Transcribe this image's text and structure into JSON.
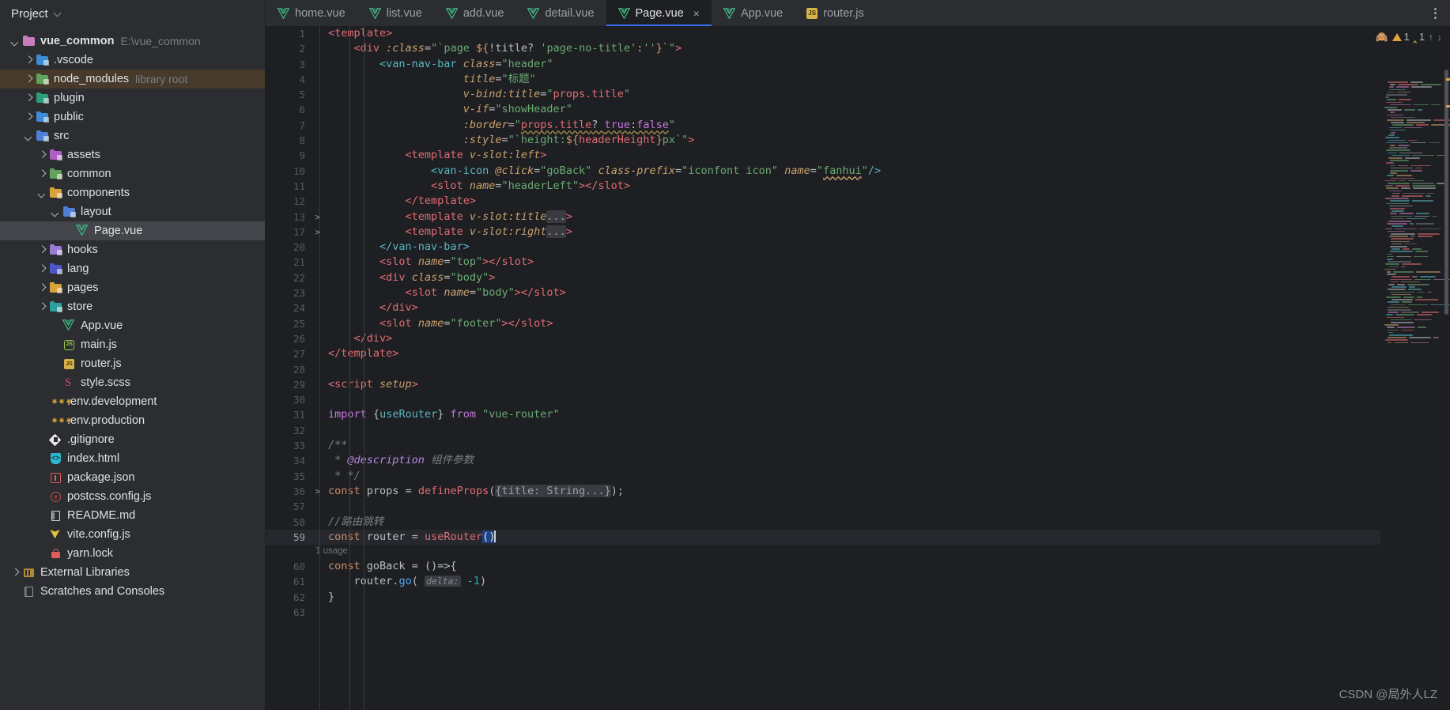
{
  "sidebar": {
    "title": "Project",
    "items": [
      {
        "label": "vue_common",
        "sub": "E:\\vue_common",
        "depth": 0,
        "twisty": "open",
        "icon": "folder-module",
        "color": "#c77dbb",
        "bold": true,
        "state": "normal"
      },
      {
        "label": ".vscode",
        "sub": "",
        "depth": 1,
        "twisty": "closed",
        "icon": "folder",
        "color": "#3c8cd6",
        "bold": false,
        "state": "normal"
      },
      {
        "label": "node_modules",
        "sub": "library root",
        "depth": 1,
        "twisty": "closed",
        "icon": "folder",
        "color": "#62a35c",
        "bold": false,
        "state": "brown"
      },
      {
        "label": "plugin",
        "sub": "",
        "depth": 1,
        "twisty": "closed",
        "icon": "folder",
        "color": "#2e9e7a",
        "bold": false,
        "state": "normal"
      },
      {
        "label": "public",
        "sub": "",
        "depth": 1,
        "twisty": "closed",
        "icon": "folder",
        "color": "#3c8cd6",
        "bold": false,
        "state": "normal"
      },
      {
        "label": "src",
        "sub": "",
        "depth": 1,
        "twisty": "open",
        "icon": "folder-source",
        "color": "#4f7fd6",
        "bold": false,
        "state": "normal"
      },
      {
        "label": "assets",
        "sub": "",
        "depth": 2,
        "twisty": "closed",
        "icon": "folder",
        "color": "#b05fc2",
        "bold": false,
        "state": "normal"
      },
      {
        "label": "common",
        "sub": "",
        "depth": 2,
        "twisty": "closed",
        "icon": "folder",
        "color": "#62a35c",
        "bold": false,
        "state": "normal"
      },
      {
        "label": "components",
        "sub": "",
        "depth": 2,
        "twisty": "open",
        "icon": "folder",
        "color": "#d8a33c",
        "bold": false,
        "state": "normal"
      },
      {
        "label": "layout",
        "sub": "",
        "depth": 3,
        "twisty": "open",
        "icon": "folder",
        "color": "#4f7fd6",
        "bold": false,
        "state": "normal"
      },
      {
        "label": "Page.vue",
        "sub": "",
        "depth": 4,
        "twisty": "none",
        "icon": "vue",
        "color": "#41b883",
        "bold": false,
        "state": "selected"
      },
      {
        "label": "hooks",
        "sub": "",
        "depth": 2,
        "twisty": "closed",
        "icon": "folder",
        "color": "#9b7ad6",
        "bold": false,
        "state": "normal"
      },
      {
        "label": "lang",
        "sub": "",
        "depth": 2,
        "twisty": "closed",
        "icon": "folder",
        "color": "#4a57c4",
        "bold": false,
        "state": "normal"
      },
      {
        "label": "pages",
        "sub": "",
        "depth": 2,
        "twisty": "closed",
        "icon": "folder",
        "color": "#d8a33c",
        "bold": false,
        "state": "normal"
      },
      {
        "label": "store",
        "sub": "",
        "depth": 2,
        "twisty": "closed",
        "icon": "folder",
        "color": "#2e9e9e",
        "bold": false,
        "state": "normal"
      },
      {
        "label": "App.vue",
        "sub": "",
        "depth": 3,
        "twisty": "none",
        "icon": "vue",
        "color": "#41b883",
        "bold": false,
        "state": "normal"
      },
      {
        "label": "main.js",
        "sub": "",
        "depth": 3,
        "twisty": "none",
        "icon": "js-round",
        "color": "#9ac94a",
        "bold": false,
        "state": "normal"
      },
      {
        "label": "router.js",
        "sub": "",
        "depth": 3,
        "twisty": "none",
        "icon": "js-sq",
        "color": "#d6b34a",
        "bold": false,
        "state": "normal"
      },
      {
        "label": "style.scss",
        "sub": "",
        "depth": 3,
        "twisty": "none",
        "icon": "scss",
        "color": "#cf4a8b",
        "bold": false,
        "state": "normal"
      },
      {
        "label": ".env.development",
        "sub": "",
        "depth": 2,
        "twisty": "none",
        "icon": "env",
        "color": "#d8a33c",
        "bold": false,
        "state": "normal"
      },
      {
        "label": ".env.production",
        "sub": "",
        "depth": 2,
        "twisty": "none",
        "icon": "env",
        "color": "#d8a33c",
        "bold": false,
        "state": "normal"
      },
      {
        "label": ".gitignore",
        "sub": "",
        "depth": 2,
        "twisty": "none",
        "icon": "git",
        "color": "#e8e8e8",
        "bold": false,
        "state": "normal"
      },
      {
        "label": "index.html",
        "sub": "",
        "depth": 2,
        "twisty": "none",
        "icon": "html",
        "color": "#2fb6cf",
        "bold": false,
        "state": "normal"
      },
      {
        "label": "package.json",
        "sub": "",
        "depth": 2,
        "twisty": "none",
        "icon": "pkg",
        "color": "#e05c5c",
        "bold": false,
        "state": "normal"
      },
      {
        "label": "postcss.config.js",
        "sub": "",
        "depth": 2,
        "twisty": "none",
        "icon": "postcss",
        "color": "#c94a4a",
        "bold": false,
        "state": "normal"
      },
      {
        "label": "README.md",
        "sub": "",
        "depth": 2,
        "twisty": "none",
        "icon": "md",
        "color": "#cfd2d6",
        "bold": false,
        "state": "normal"
      },
      {
        "label": "vite.config.js",
        "sub": "",
        "depth": 2,
        "twisty": "none",
        "icon": "vite",
        "color": "#e3c23c",
        "bold": false,
        "state": "normal"
      },
      {
        "label": "yarn.lock",
        "sub": "",
        "depth": 2,
        "twisty": "none",
        "icon": "lock",
        "color": "#e05c5c",
        "bold": false,
        "state": "normal"
      },
      {
        "label": "External Libraries",
        "sub": "",
        "depth": 0,
        "twisty": "closed",
        "icon": "lib",
        "color": "#b0883c",
        "bold": false,
        "state": "normal"
      },
      {
        "label": "Scratches and Consoles",
        "sub": "",
        "depth": 0,
        "twisty": "none",
        "icon": "scratch",
        "color": "#8f949c",
        "bold": false,
        "state": "normal"
      }
    ]
  },
  "tabs": [
    {
      "label": "home.vue",
      "icon": "vue",
      "active": false,
      "closable": false
    },
    {
      "label": "list.vue",
      "icon": "vue",
      "active": false,
      "closable": false
    },
    {
      "label": "add.vue",
      "icon": "vue",
      "active": false,
      "closable": false
    },
    {
      "label": "detail.vue",
      "icon": "vue",
      "active": false,
      "closable": false
    },
    {
      "label": "Page.vue",
      "icon": "vue",
      "active": true,
      "closable": true,
      "close_label": "×"
    },
    {
      "label": "App.vue",
      "icon": "vue",
      "active": false,
      "closable": false
    },
    {
      "label": "router.js",
      "icon": "js",
      "active": false,
      "closable": false
    }
  ],
  "inspection": {
    "warning_count": "1",
    "typo_count": "1",
    "eye_icon": "eye-off-icon",
    "warning_icon": "warning-triangle-icon",
    "typo_icon": "typo-icon",
    "up_arrow": "↑",
    "down_arrow": "↓",
    "accent": "#3574f0"
  },
  "editor": {
    "usage_hint": "1 usage",
    "current_line": 59,
    "lines": [
      {
        "n": "1",
        "fold": "",
        "indent": 0
      },
      {
        "n": "2",
        "fold": "",
        "indent": 1
      },
      {
        "n": "3",
        "fold": "",
        "indent": 2
      },
      {
        "n": "4",
        "fold": "",
        "indent": 2
      },
      {
        "n": "5",
        "fold": "",
        "indent": 2
      },
      {
        "n": "6",
        "fold": "",
        "indent": 2
      },
      {
        "n": "7",
        "fold": "",
        "indent": 2
      },
      {
        "n": "8",
        "fold": "",
        "indent": 2
      },
      {
        "n": "9",
        "fold": "",
        "indent": 2
      },
      {
        "n": "10",
        "fold": "",
        "indent": 3
      },
      {
        "n": "11",
        "fold": "",
        "indent": 3
      },
      {
        "n": "12",
        "fold": "",
        "indent": 2
      },
      {
        "n": "13",
        "fold": ">",
        "indent": 2
      },
      {
        "n": "17",
        "fold": ">",
        "indent": 2
      },
      {
        "n": "20",
        "fold": "",
        "indent": 2
      },
      {
        "n": "21",
        "fold": "",
        "indent": 2
      },
      {
        "n": "22",
        "fold": "",
        "indent": 2
      },
      {
        "n": "23",
        "fold": "",
        "indent": 3
      },
      {
        "n": "24",
        "fold": "",
        "indent": 2
      },
      {
        "n": "25",
        "fold": "",
        "indent": 2
      },
      {
        "n": "26",
        "fold": "",
        "indent": 1
      },
      {
        "n": "27",
        "fold": "",
        "indent": 0
      },
      {
        "n": "28",
        "fold": "",
        "indent": 0
      },
      {
        "n": "29",
        "fold": "",
        "indent": 0
      },
      {
        "n": "30",
        "fold": "",
        "indent": 0
      },
      {
        "n": "31",
        "fold": "",
        "indent": 0
      },
      {
        "n": "32",
        "fold": "",
        "indent": 0
      },
      {
        "n": "33",
        "fold": "",
        "indent": 0
      },
      {
        "n": "34",
        "fold": "",
        "indent": 0
      },
      {
        "n": "35",
        "fold": "",
        "indent": 0
      },
      {
        "n": "36",
        "fold": ">",
        "indent": 0
      },
      {
        "n": "57",
        "fold": "",
        "indent": 0
      },
      {
        "n": "58",
        "fold": "",
        "indent": 0
      },
      {
        "n": "59",
        "fold": "",
        "indent": 0
      },
      {
        "n": "60",
        "fold": "",
        "indent": 0
      },
      {
        "n": "61",
        "fold": "",
        "indent": 0
      },
      {
        "n": "62",
        "fold": "",
        "indent": 0
      },
      {
        "n": "63",
        "fold": "",
        "indent": 0
      }
    ],
    "code_plain": [
      "<template>",
      "    <div :class=\"`page ${!title? 'page-no-title':''}`\">",
      "        <van-nav-bar class=\"header\"",
      "                     title=\"标题\"",
      "                     v-bind:title=\"props.title\"",
      "                     v-if=\"showHeader\"",
      "                     :border=\"props.title? true:false\"",
      "                     :style=\"`height:${headerHeight}px`\">",
      "            <template v-slot:left>",
      "                <van-icon @click=\"goBack\" class-prefix=\"iconfont icon\" name=\"fanhui\"/>",
      "                <slot name=\"headerLeft\"></slot>",
      "            </template>",
      "            <template v-slot:title...>",
      "            <template v-slot:right...>",
      "        </van-nav-bar>",
      "        <slot name=\"top\"></slot>",
      "        <div class=\"body\">",
      "            <slot name=\"body\"></slot>",
      "        </div>",
      "        <slot name=\"footer\"></slot>",
      "    </div>",
      "</template>",
      "",
      "<script setup>",
      "",
      "import {useRouter} from \"vue-router\"",
      "",
      "/**",
      " * @description 组件参数",
      " * */",
      "const props = defineProps({title: String...});",
      "",
      "//路由跳转",
      "const router = useRouter()",
      "const goBack = ()=>{",
      "    router.go( delta: -1)",
      "}"
    ]
  },
  "watermark": "CSDN @局外人LZ"
}
